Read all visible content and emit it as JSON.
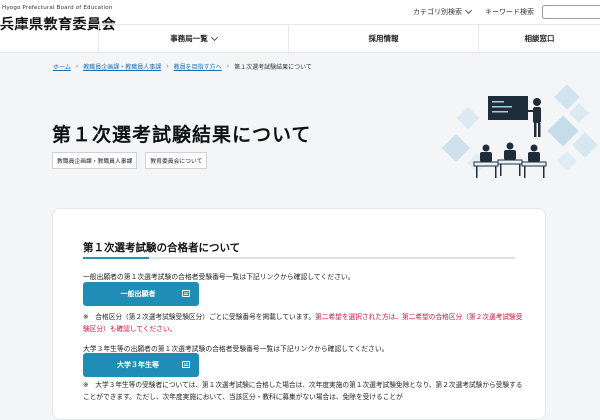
{
  "header": {
    "logo_sub": "Hyogo Prefectural Board of Education",
    "logo_main": "兵庫県教育委員会",
    "category_search": "カテゴリ別検索",
    "keyword_search": "キーワード検索",
    "search_placeholder": ""
  },
  "nav": {
    "items": [
      {
        "label": "事務局一覧"
      },
      {
        "label": "採用情報"
      },
      {
        "label": "相談窓口"
      }
    ]
  },
  "breadcrumb": [
    {
      "label": "ホーム"
    },
    {
      "label": "教職員企画課・教職員人事課"
    },
    {
      "label": "教員を目指す方へ"
    },
    {
      "label": "第１次選考試験結果について"
    }
  ],
  "page": {
    "title": "第１次選考試験結果について",
    "tags": [
      "教職員企画課・教職員人事課",
      "教育委員会について"
    ]
  },
  "content": {
    "section_title": "第１次選考試験の合格者について",
    "para1": "一般出願者の第１次選考試験の合格者受験番号一覧は下記リンクから確認してください。",
    "button1": "一般出願者",
    "note1_prefix": "※　合格区分（第２次選考試験受験区分）ごとに受験番号を掲載しています。",
    "note1_red": "第二希望を選択された方は、第二希望の合格区分（第２次選考試験受験区分）も確認してください。",
    "para2": "大学３年生等の出願者の第１次選考試験の合格者受験番号一覧は下記リンクから確認してください。",
    "button2": "大学３年生等",
    "note2": "※　大学３年生等の受験者については、第１次選考試験に合格した場合は、次年度実施の第１次選考試験免除となり、第２次選考試験から受験することができます。ただし、次年度実施において、当該区分・教科に募集がない場合は、免除を受けることが"
  },
  "colors": {
    "accent": "#1f8db6",
    "link": "#1c6fb4",
    "notice_red": "#c8143d"
  },
  "icons": {
    "chevron": "chevron-down-icon",
    "pdf": "document-icon"
  }
}
